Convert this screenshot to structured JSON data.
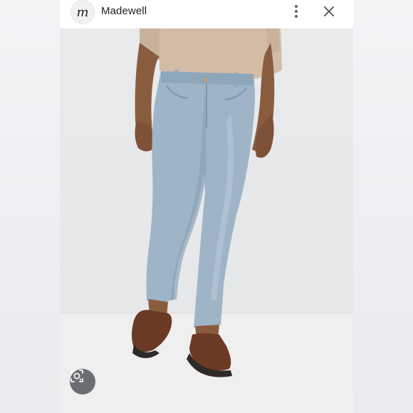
{
  "header": {
    "logo_letter": "m",
    "brand_name": "Madewell",
    "more_icon": "more-vert-icon",
    "close_icon": "close-icon"
  },
  "image": {
    "lens_icon": "google-lens-icon"
  },
  "colors": {
    "denim": "#9db3c6",
    "tee": "#d2b9a2",
    "loafer": "#6a3a24",
    "button": "#5f6368"
  }
}
